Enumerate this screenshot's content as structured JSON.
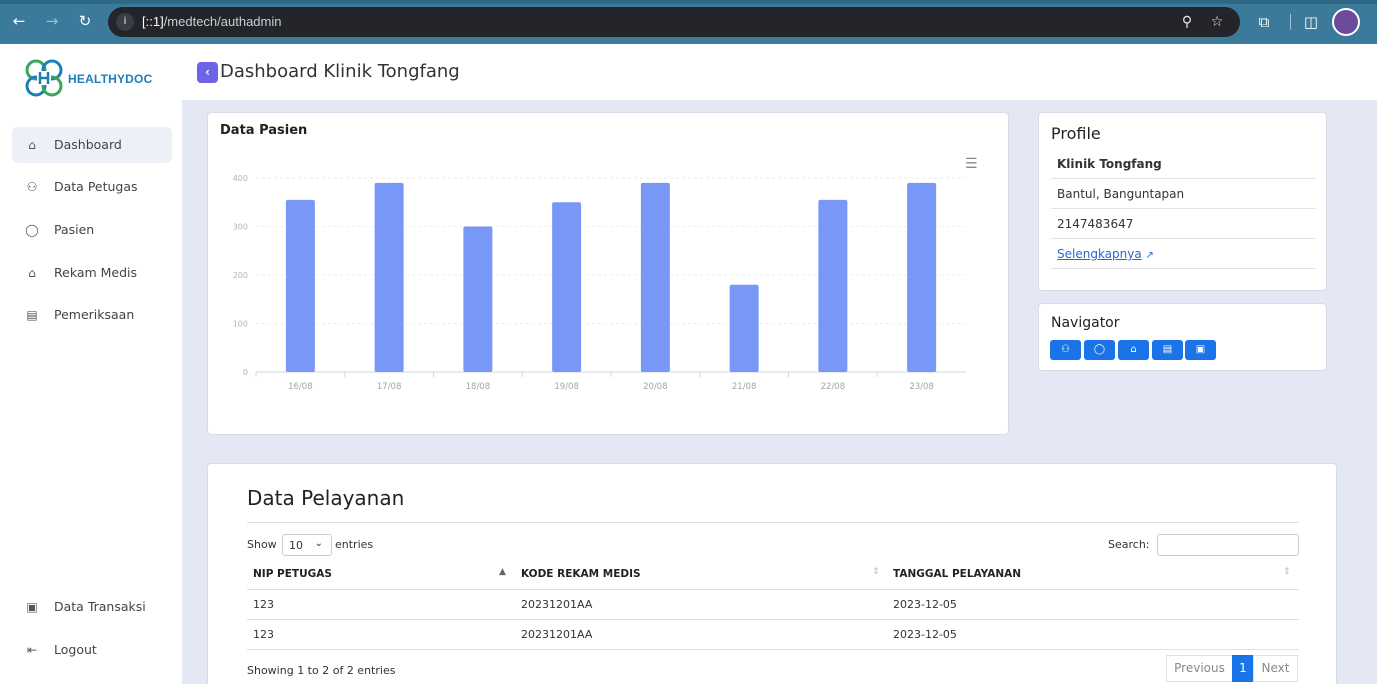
{
  "browser": {
    "url_prefix": "[::1]",
    "url_path": "/medtech/authadmin"
  },
  "sidebar": {
    "logo_text": "HEALTHYDOC",
    "items": [
      {
        "label": "Dashboard",
        "icon": "home-icon"
      },
      {
        "label": "Data Petugas",
        "icon": "users-icon"
      },
      {
        "label": "Pasien",
        "icon": "user-icon"
      },
      {
        "label": "Rekam Medis",
        "icon": "house-medical-icon"
      },
      {
        "label": "Pemeriksaan",
        "icon": "file-icon"
      }
    ],
    "bottom_items": [
      {
        "label": "Data Transaksi",
        "icon": "wallet-icon"
      },
      {
        "label": "Logout",
        "icon": "logout-icon"
      }
    ]
  },
  "header": {
    "title": "Dashboard Klinik Tongfang"
  },
  "chart_card": {
    "title": "Data Pasien"
  },
  "chart_data": {
    "type": "bar",
    "categories": [
      "16/08",
      "17/08",
      "18/08",
      "19/08",
      "20/08",
      "21/08",
      "22/08",
      "23/08"
    ],
    "values": [
      355,
      390,
      300,
      350,
      390,
      180,
      355,
      390
    ],
    "yticks": [
      0,
      100,
      200,
      300,
      400
    ],
    "ylim": [
      0,
      400
    ],
    "color": "#7897f7",
    "grid": true
  },
  "profile": {
    "title": "Profile",
    "name": "Klinik Tongfang",
    "address": "Bantul, Banguntapan",
    "phone": "2147483647",
    "more_link": "Selengkapnya"
  },
  "navigator": {
    "title": "Navigator",
    "buttons": [
      "users-icon",
      "user-icon",
      "house-medical-icon",
      "file-icon",
      "wallet-icon"
    ]
  },
  "table": {
    "title": "Data Pelayanan",
    "show_label": "Show",
    "show_value": "10",
    "entries_label": "entries",
    "search_label": "Search:",
    "columns": [
      "NIP PETUGAS",
      "KODE REKAM MEDIS",
      "TANGGAL PELAYANAN"
    ],
    "rows": [
      [
        "123",
        "20231201AA",
        "2023-12-05"
      ],
      [
        "123",
        "20231201AA",
        "2023-12-05"
      ]
    ],
    "info": "Showing 1 to 2 of 2 entries",
    "pagination": {
      "previous": "Previous",
      "current": "1",
      "next": "Next"
    }
  },
  "colors": {
    "accent": "#1a74e8",
    "back_button": "#6c63e8",
    "bar": "#7897f7"
  }
}
